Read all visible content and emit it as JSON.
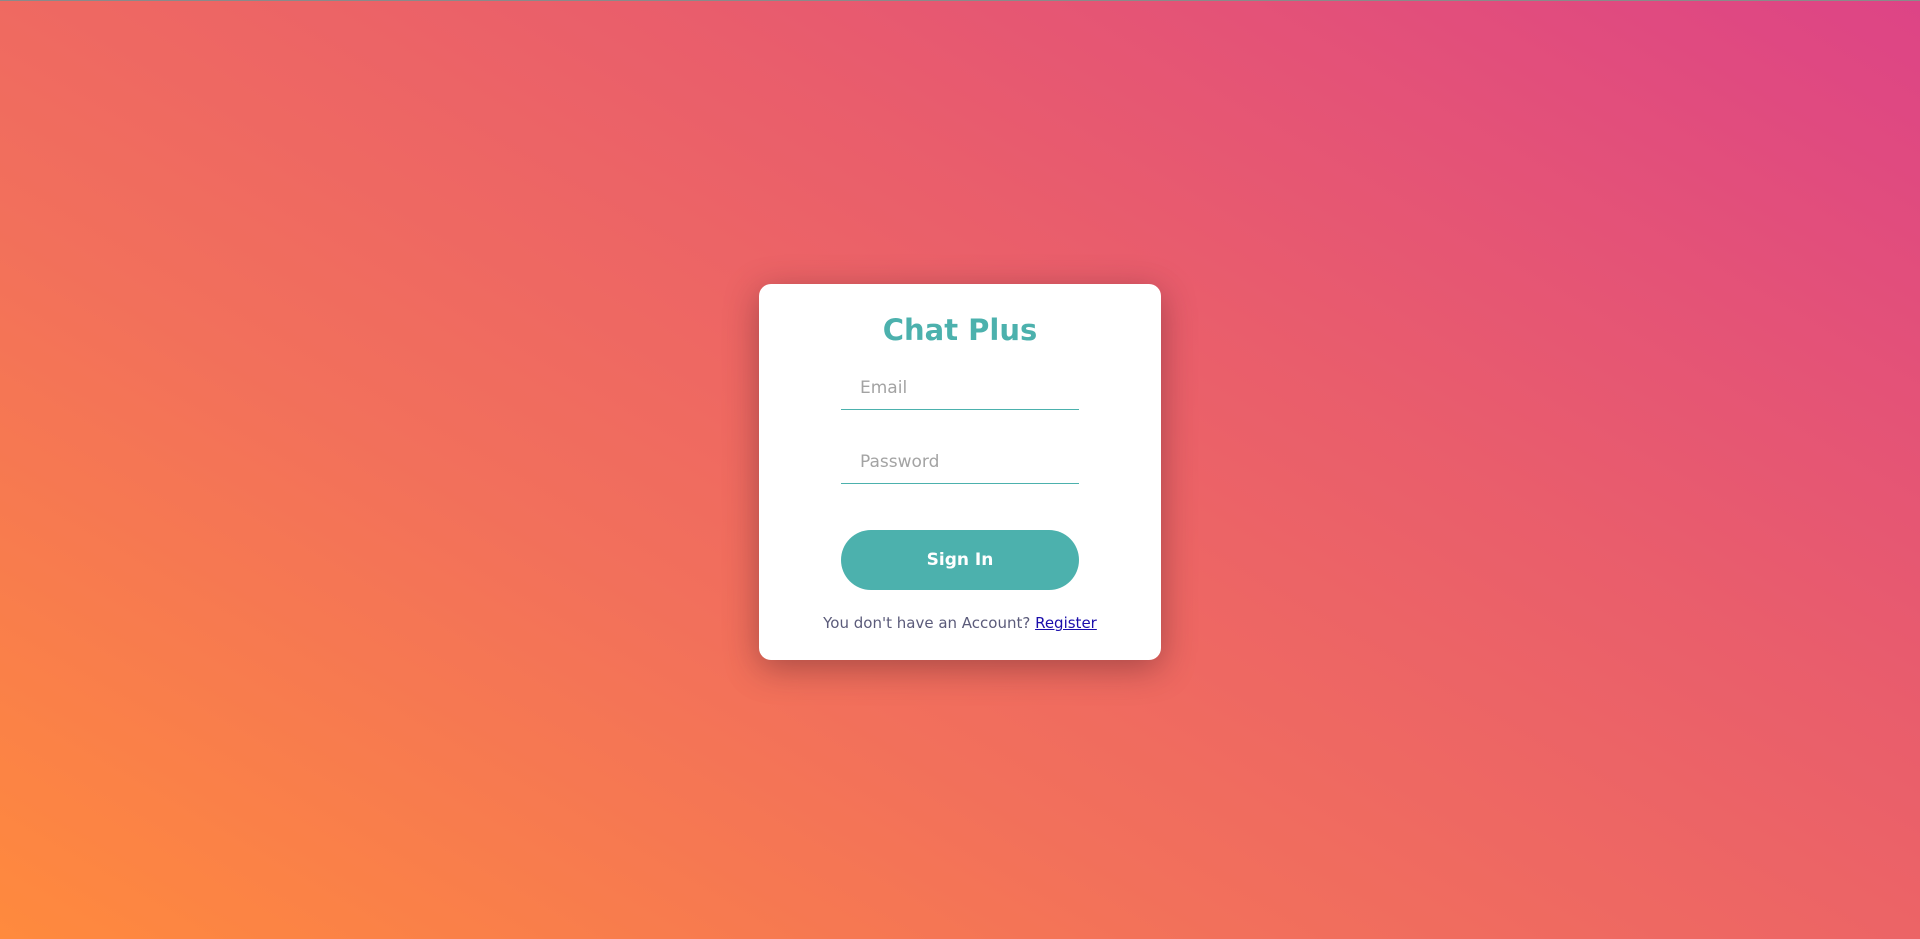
{
  "app": {
    "title": "Chat Plus"
  },
  "login": {
    "email_placeholder": "Email",
    "email_value": "",
    "password_placeholder": "Password",
    "password_value": "",
    "signin_label": "Sign In",
    "footer_text": "You don't have an Account?",
    "register_link": "Register"
  },
  "colors": {
    "accent": "#4cb1ad",
    "link": "#1a0dab",
    "card": "#ffffff",
    "gradient_start": "#ff8a3d",
    "gradient_end": "#dd4486"
  }
}
